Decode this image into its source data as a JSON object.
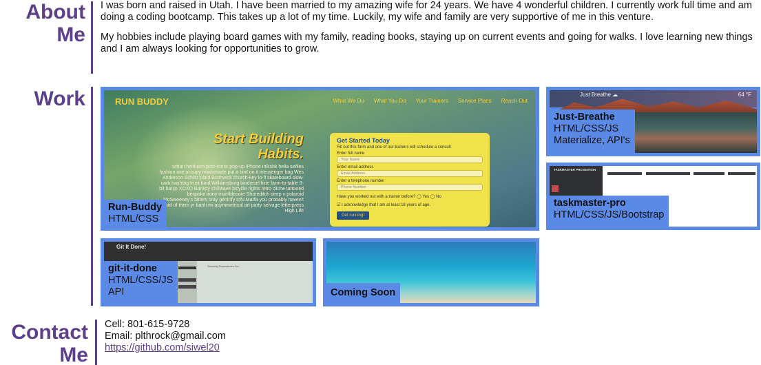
{
  "about": {
    "heading_line1": "About",
    "heading_line2": "Me",
    "paragraph1": "I was born and raised in Utah. I have been married to my amazing wife for 24 years. We have 4 wonderful children. I currently work full time and am doing a coding bootcamp. This takes up a lot of my time. Luckily, my wife and family are very supportive of me in this venture.",
    "paragraph2": "My hobbies include playing board games with my family, reading books, staying up on current events and going for walks. I love learning new things and I am always looking for opportunities to grow."
  },
  "work": {
    "heading": "Work",
    "projects": [
      {
        "name": "Run-Buddy",
        "tech": "HTML/CSS",
        "shot": {
          "logo": "RUN BUDDY",
          "nav": [
            "What We Do",
            "What You Do",
            "Your Trainers",
            "Service Plans",
            "Reach Out"
          ],
          "hero": "Start Building Habits.",
          "lorem": "seitan heirloom post-ironic pop-up iPhone mlkshk hella selfies fashion axe occupy readymade put a bird on it messenger bag Wes Anderson Schlitz plaid Bushwick church-key lo-fi skateboard slow-carb hashtag trust fund Williamsburg biodiesel fixie farm-to-table 8-bit banjo XOXO Banksy chillwave bicycle rights retro cliche tattooed bespoke irony mumblecore Shoreditch deep v polaroid McSweeney's bitters cray gentrify tofu Marfa you probably haven't heard of them yr banh mi asymmetrical art party selvage letterpress High Life",
          "form_title": "Get Started Today",
          "form_sub": "Fill out this form and one of our trainers will schedule a consult",
          "label_name": "Enter full name",
          "placeholder_name": "Your Name",
          "label_email": "Enter email address",
          "placeholder_email": "Email Address",
          "label_phone": "Enter a telephone number",
          "placeholder_phone": "Phone Number",
          "question": "Have you worked out with a trainer before?  ◯ Yes  ◯ No",
          "ack": "I acknowledge that I am at least 18 years of age.",
          "button": "Get running!"
        }
      },
      {
        "name": "Just-Breathe",
        "tech": "HTML/CSS/JS",
        "tech2": "Materialize, API's",
        "shot": {
          "title": "Just Breathe ☁",
          "temp": "64 °F"
        }
      },
      {
        "name": "taskmaster-pro",
        "tech": "HTML/CSS/JS/Bootstrap",
        "shot": {
          "title": "TASKMASTER PRO EDITION"
        }
      },
      {
        "name": "git-it-done",
        "tech": "HTML/CSS/JS",
        "tech2": "API",
        "shot": {
          "title": "Git It Done!",
          "subhead": "Showing Repositories For:"
        }
      },
      {
        "name": "Coming Soon"
      }
    ]
  },
  "contact": {
    "heading_line1": "Contact",
    "heading_line2": "Me",
    "cell": "Cell: 801-615-9728",
    "email": "Email: plthrock@gmail.com",
    "github": "https://github.com/siwel20"
  },
  "colors": {
    "accent": "#5d3f8a",
    "card": "#5b8ae6"
  }
}
